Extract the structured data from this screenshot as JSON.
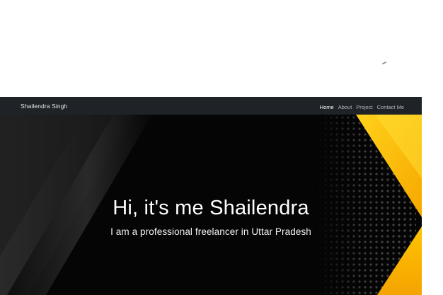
{
  "navbar": {
    "brand": "Shailendra Singh",
    "links": [
      {
        "label": "Home",
        "active": true
      },
      {
        "label": "About",
        "active": false
      },
      {
        "label": "Project",
        "active": false
      },
      {
        "label": "Contact Me",
        "active": false
      }
    ]
  },
  "hero": {
    "title": "Hi, it's me Shailendra",
    "subtitle": "I am a professional freelancer in Uttar Pradesh"
  },
  "colors": {
    "navbar_bg": "#1f2327",
    "hero_bg": "#050505",
    "accent_yellow": "#ffc400",
    "nav_active": "#ffffff",
    "nav_inactive": "#b5b8bb"
  }
}
